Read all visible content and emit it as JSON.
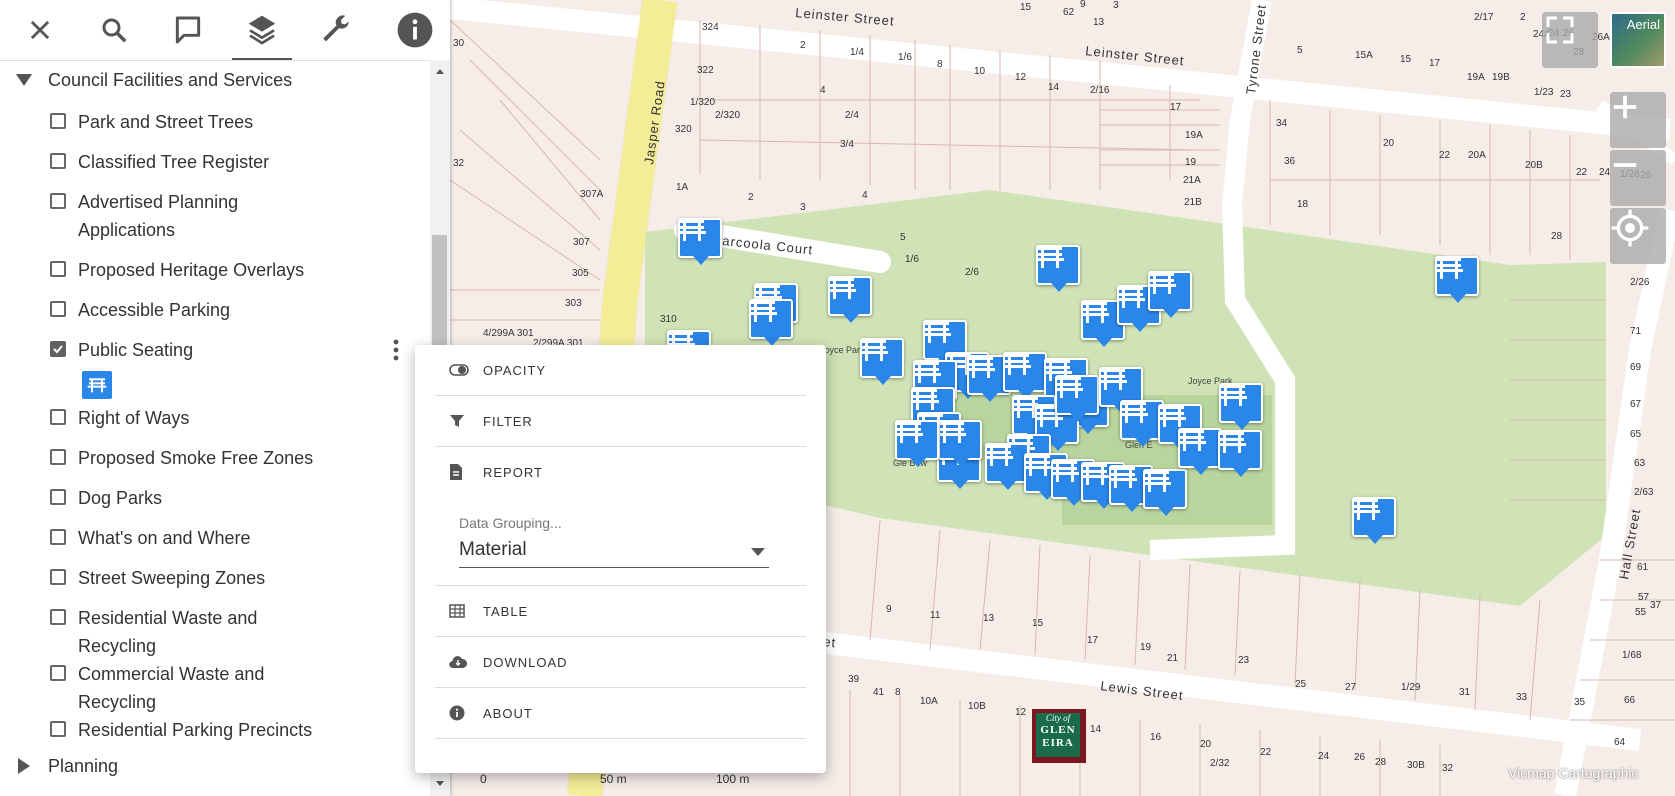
{
  "toolbar": {
    "buttons": [
      {
        "name": "close",
        "icon": "close-icon"
      },
      {
        "name": "search",
        "icon": "search-icon"
      },
      {
        "name": "comments",
        "icon": "comment-icon"
      },
      {
        "name": "layers",
        "icon": "layers-icon",
        "active": true
      },
      {
        "name": "tools",
        "icon": "wrench-icon"
      },
      {
        "name": "info",
        "icon": "info-icon"
      }
    ]
  },
  "layer_groups": {
    "council": {
      "label": "Council Facilities and Services",
      "expanded": true,
      "items": [
        {
          "label": "Park and Street Trees",
          "checked": false
        },
        {
          "label": "Classified Tree Register",
          "checked": false
        },
        {
          "label": "Advertised Planning Applications",
          "checked": false
        },
        {
          "label": "Proposed Heritage Overlays",
          "checked": false
        },
        {
          "label": "Accessible Parking",
          "checked": false
        },
        {
          "label": "Public Seating",
          "checked": true
        },
        {
          "label": "Right of Ways",
          "checked": false
        },
        {
          "label": "Proposed Smoke Free Zones",
          "checked": false
        },
        {
          "label": "Dog Parks",
          "checked": false
        },
        {
          "label": "What's on and Where",
          "checked": false
        },
        {
          "label": "Street Sweeping Zones",
          "checked": false
        },
        {
          "label": "Residential Waste and Recycling",
          "checked": false
        },
        {
          "label": "Commercial Waste and Recycling",
          "checked": false
        },
        {
          "label": "Residential Parking Precincts",
          "checked": false
        }
      ]
    },
    "planning": {
      "label": "Planning",
      "expanded": false
    }
  },
  "layer_menu": {
    "opacity": "OPACITY",
    "filter": "FILTER",
    "report": "REPORT",
    "grouping_label": "Data Grouping...",
    "grouping_value": "Material",
    "table": "TABLE",
    "download": "DOWNLOAD",
    "about": "ABOUT"
  },
  "map": {
    "basemap_toggle": "Aerial",
    "attribution": "Vicmap Cartographic",
    "scale": {
      "zero": "0",
      "mid": "50 m",
      "end": "100 m"
    },
    "logo": {
      "line1": "City of",
      "line2": "GLEN",
      "line3": "EIRA"
    },
    "streets": {
      "leinster1": "Leinster Street",
      "leinster2": "Leinster Street",
      "tyrone": "Tyrone Street",
      "jasper": "Jasper Road",
      "marcoola": "arcoola Court",
      "lewis": "Lewis Street",
      "hall": "Hall Street",
      "west_frag": "et"
    },
    "park_labels": {
      "joyce1": "Joyce Park",
      "joyce2": "Joyce Park",
      "glen": "Glen E",
      "glen_bow": "Gle Bow"
    },
    "lot_numbers": [
      "324",
      "2",
      "1/4",
      "1/6",
      "8",
      "10",
      "12",
      "14",
      "2/16",
      "17",
      "19A",
      "19",
      "21A",
      "21B",
      "322",
      "1/320",
      "2/320",
      "320",
      "4",
      "2/4",
      "3/4",
      "1A",
      "2",
      "3",
      "4",
      "307A",
      "5",
      "1/6",
      "2/6",
      "307",
      "305",
      "303",
      "310",
      "4/299A 301",
      "2/299A 301",
      "9",
      "11",
      "13",
      "15",
      "17",
      "19",
      "21",
      "23",
      "25",
      "27",
      "1/29",
      "31",
      "33",
      "35",
      "37",
      "39",
      "41",
      "8",
      "10A",
      "10B",
      "12",
      "14",
      "16",
      "20",
      "22",
      "24",
      "26",
      "28",
      "30B",
      "32",
      "2/32",
      "34",
      "36",
      "18",
      "20",
      "22",
      "20A",
      "20B",
      "22",
      "24",
      "1/26",
      "26",
      "28",
      "2/26",
      "71",
      "69",
      "67",
      "65",
      "63",
      "2/63",
      "61",
      "57",
      "55",
      "1/68",
      "66",
      "64",
      "62",
      "13",
      "15",
      "9",
      "3",
      "5",
      "15A",
      "15",
      "17",
      "19A",
      "19B",
      "1/23",
      "23",
      "2/17",
      "2",
      "24A",
      "24",
      "26",
      "28",
      "26A",
      "30",
      "32"
    ],
    "seat_marker_count": 38
  }
}
